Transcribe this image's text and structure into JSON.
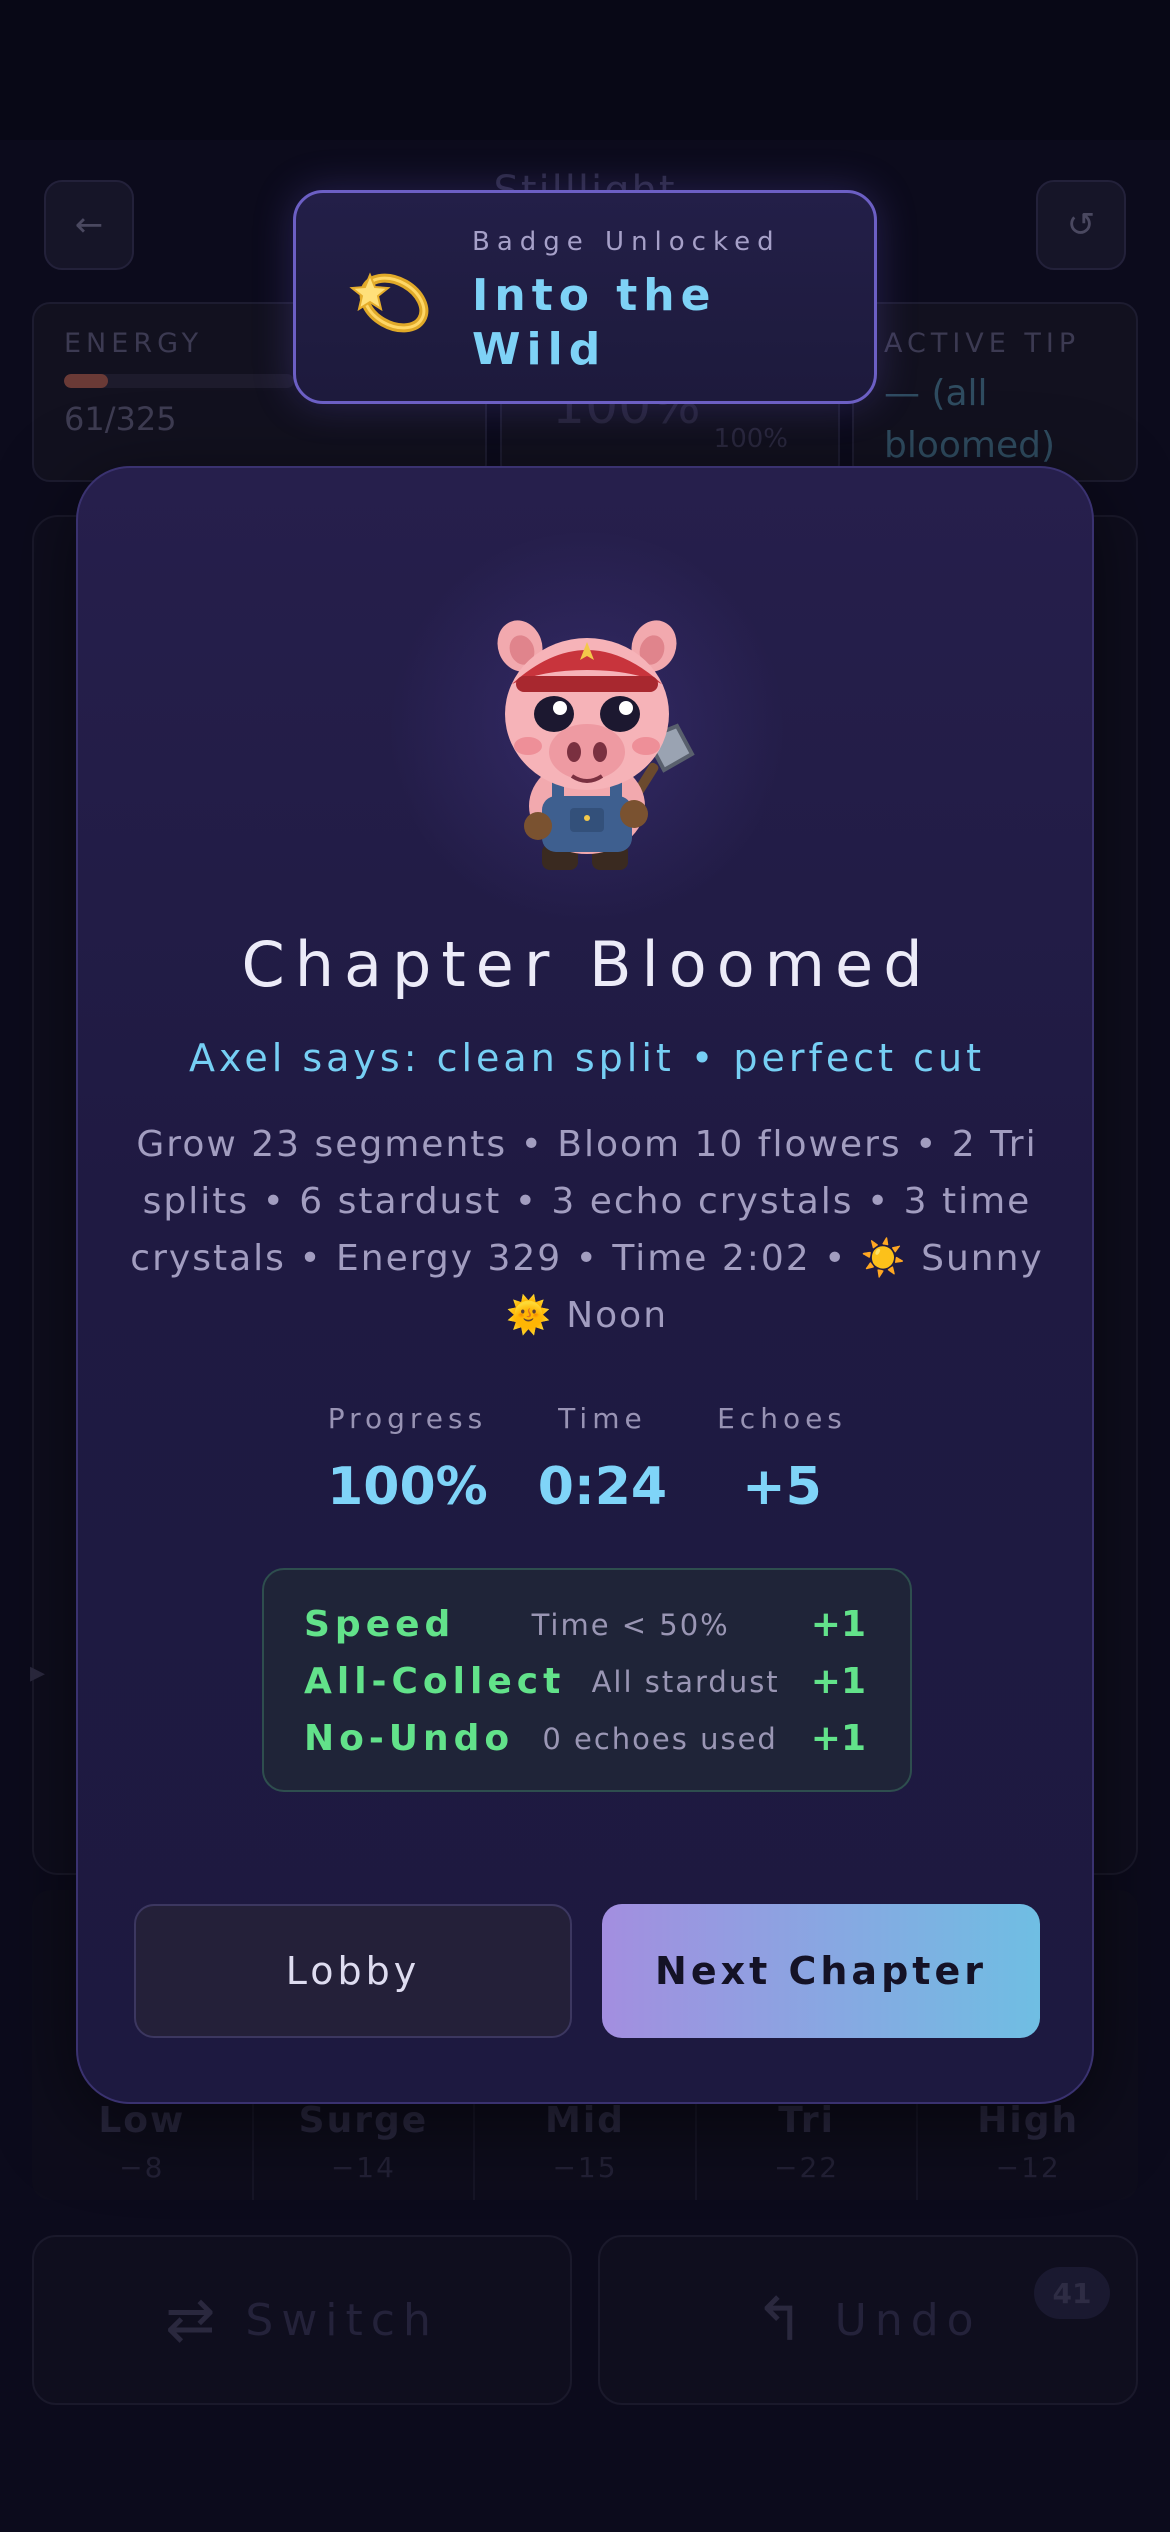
{
  "background": {
    "title": "Stilllight",
    "back_icon": "arrow-left-icon",
    "restart_icon": "restart-icon",
    "energy": {
      "label": "ENERGY",
      "value": "61/325",
      "fill_fraction": 0.19,
      "fill_color": "#6a3a36"
    },
    "progress": {
      "big": "100%",
      "small": "100%"
    },
    "tip": {
      "label": "ACTIVE TIP",
      "value": "— (all bloomed)"
    },
    "lanes": [
      {
        "name": "Low",
        "value": "−8"
      },
      {
        "name": "Surge",
        "value": "−14"
      },
      {
        "name": "Mid",
        "value": "−15"
      },
      {
        "name": "Tri",
        "value": "−22"
      },
      {
        "name": "High",
        "value": "−12"
      }
    ],
    "actions": {
      "switch_label": "Switch",
      "switch_icon": "swap-arrows-icon",
      "undo_label": "Undo",
      "undo_icon": "undo-icon",
      "undo_count": "41"
    }
  },
  "badge": {
    "kicker": "Badge Unlocked",
    "name": "Into the Wild",
    "icon": "shooting-star-icon"
  },
  "modal": {
    "mascot": "pig-miner-mascot",
    "title": "Chapter Bloomed",
    "quote": "Axel says: clean split • perfect cut",
    "summary": "Grow 23 segments • Bloom 10 flowers • 2 Tri splits • 6 stardust • 3 echo crystals • 3 time crystals • Energy 329 • Time 2:02 • ☀️ Sunny 🌞 Noon",
    "metrics": [
      {
        "label": "Progress",
        "value": "100%"
      },
      {
        "label": "Time",
        "value": "0:24"
      },
      {
        "label": "Echoes",
        "value": "+5"
      }
    ],
    "bonuses": [
      {
        "name": "Speed",
        "desc": "Time < 50%",
        "points": "+1"
      },
      {
        "name": "All-Collect",
        "desc": "All stardust",
        "points": "+1"
      },
      {
        "name": "No-Undo",
        "desc": "0 echoes used",
        "points": "+1"
      }
    ],
    "buttons": {
      "lobby": "Lobby",
      "next": "Next Chapter"
    }
  },
  "colors": {
    "accent_cyan": "#7ed2f6",
    "bonus_green": "#62e28a",
    "modal_bg": "#1f1a42",
    "badge_border": "#6c5fc4"
  }
}
